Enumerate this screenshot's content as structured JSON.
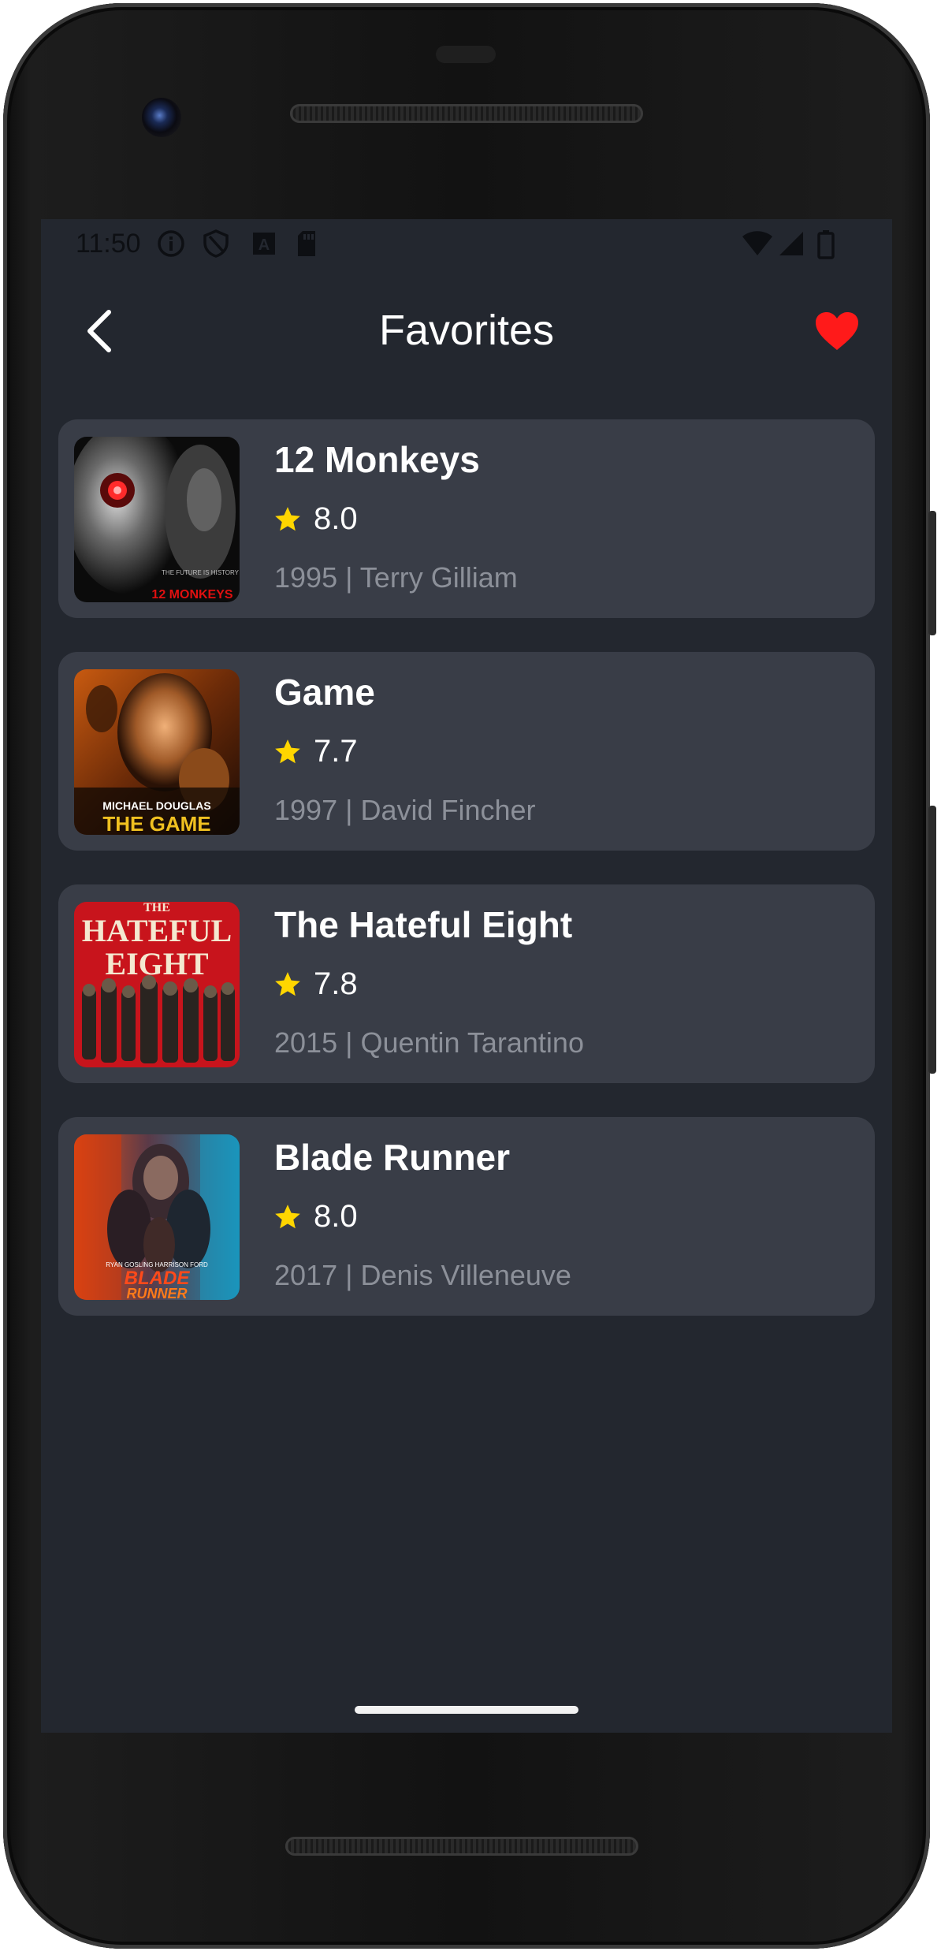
{
  "status_bar": {
    "time": "11:50",
    "icons": [
      "info-icon",
      "shield-icon",
      "font-a-icon",
      "sd-card-icon",
      "wifi-icon",
      "signal-icon",
      "battery-icon"
    ]
  },
  "app_bar": {
    "back_icon": "chevron-left-icon",
    "title": "Favorites",
    "favorite_icon": "heart-icon",
    "favorite_color": "#ff1a1a"
  },
  "favorites": [
    {
      "title": "12 Monkeys",
      "rating": "8.0",
      "meta": "1995 | Terry Gilliam",
      "poster_text": "12 MONKEYS",
      "poster_tagline": "THE FUTURE IS HISTORY"
    },
    {
      "title": "Game",
      "rating": "7.7",
      "meta": "1997 | David Fincher",
      "poster_text": "THE GAME",
      "poster_tagline": "MICHAEL DOUGLAS"
    },
    {
      "title": "The Hateful Eight",
      "rating": "7.8",
      "meta": "2015 | Quentin Tarantino",
      "poster_text": "HATEFUL",
      "poster_text2": "EIGHT",
      "poster_top": "THE"
    },
    {
      "title": "Blade Runner",
      "rating": "8.0",
      "meta": "2017 | Denis Villeneuve",
      "poster_text": "BLADE",
      "poster_text2": "RUNNER",
      "poster_tagline": "RYAN GOSLING  HARRISON FORD"
    }
  ],
  "colors": {
    "screen_bg": "#23272f",
    "card_bg": "#393d47",
    "star": "#ffd600",
    "meta_text": "#8c9099"
  }
}
